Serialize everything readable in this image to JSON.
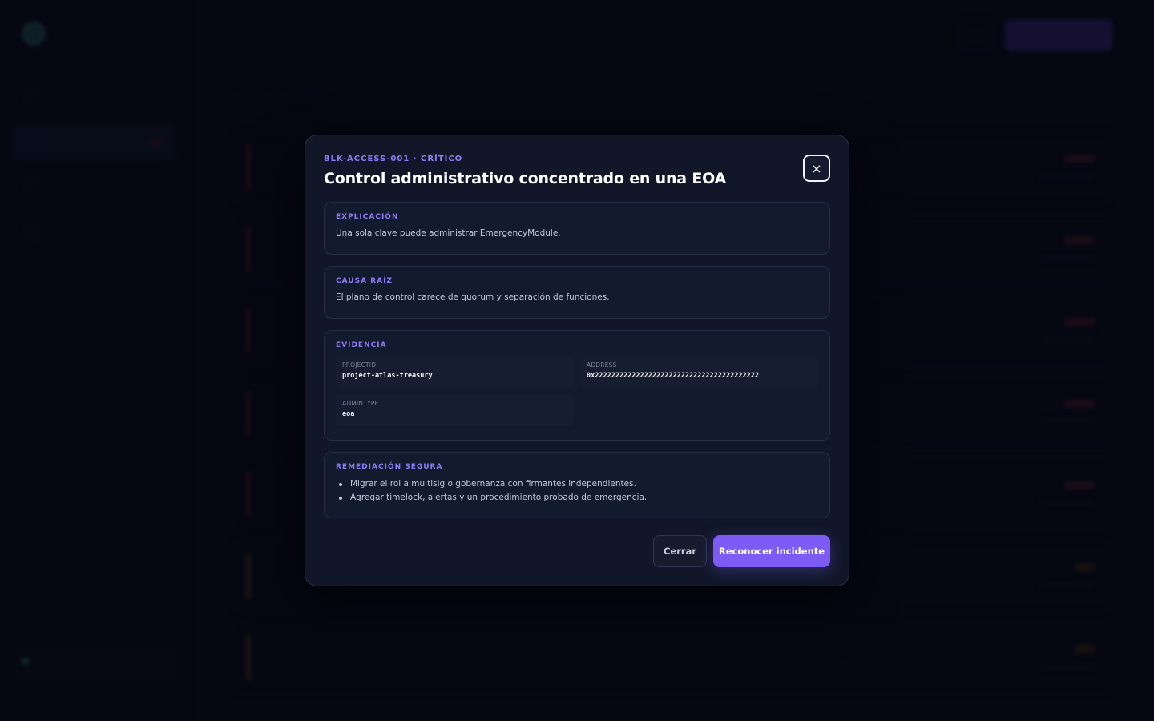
{
  "modal": {
    "eyebrow": "BLK-ACCESS-001 · CRÍTICO",
    "title": "Control administrativo concentrado en una EOA",
    "close_icon": "×",
    "explanation": {
      "label": "EXPLICACIÓN",
      "text": "Una sola clave puede administrar EmergencyModule."
    },
    "root_cause": {
      "label": "CAUSA RAÍZ",
      "text": "El plano de control carece de quorum y separación de funciones."
    },
    "evidence": {
      "label": "EVIDENCIA",
      "items": [
        {
          "key": "PROJECTID",
          "value": "project-atlas-treasury"
        },
        {
          "key": "ADDRESS",
          "value": "0x2222222222222222222222222222222222222222"
        },
        {
          "key": "ADMINTYPE",
          "value": "eoa"
        }
      ]
    },
    "remediation": {
      "label": "REMEDIACIÓN SEGURA",
      "items": [
        "Migrar el rol a multisig o gobernanza con firmantes independientes.",
        "Agregar timelock, alertas y un procedimiento probado de emergencia."
      ]
    },
    "actions": {
      "close_label": "Cerrar",
      "ack_label": "Reconocer incidente"
    }
  },
  "colors": {
    "accent": "#8b7cf5",
    "primary_button": "#7c5cf5",
    "critical": "#3a1624"
  }
}
